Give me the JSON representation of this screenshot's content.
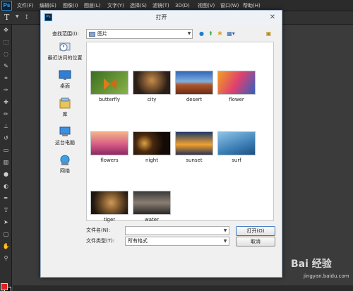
{
  "app": {
    "logo": "Ps",
    "menu": [
      "文件(F)",
      "编辑(E)",
      "图像(I)",
      "图层(L)",
      "文字(Y)",
      "选择(S)",
      "滤镜(T)",
      "3D(D)",
      "视图(V)",
      "窗口(W)",
      "帮助(H)"
    ],
    "options_tool": "T",
    "foreground_color": "#e02020",
    "background_color": "#000000"
  },
  "dialog": {
    "title": "打开",
    "close_icon": "close-icon",
    "look_in_label": "查找范围(I):",
    "look_in_value": "图片",
    "places": [
      "最近访问的位置",
      "桌面",
      "库",
      "这台电脑",
      "网络"
    ],
    "files": [
      {
        "name": "butterfly",
        "icon": "butterfly-thumbnail"
      },
      {
        "name": "city",
        "icon": "city-thumbnail"
      },
      {
        "name": "desert",
        "icon": "desert-thumbnail"
      },
      {
        "name": "flower",
        "icon": "flower-thumbnail"
      },
      {
        "name": "flowers",
        "icon": "flowers-thumbnail"
      },
      {
        "name": "night",
        "icon": "night-thumbnail"
      },
      {
        "name": "sunset",
        "icon": "sunset-thumbnail"
      },
      {
        "name": "surf",
        "icon": "surf-thumbnail"
      },
      {
        "name": "tiger",
        "icon": "tiger-thumbnail"
      },
      {
        "name": "water",
        "icon": "water-thumbnail"
      }
    ],
    "filename_label": "文件名(N):",
    "filename_value": "",
    "filetype_label": "文件类型(T):",
    "filetype_value": "所有格式",
    "open_button": "打开(O)",
    "cancel_button": "取消"
  },
  "watermark": {
    "text": "Bai 经验",
    "sub": "jingyan.baidu.com"
  }
}
